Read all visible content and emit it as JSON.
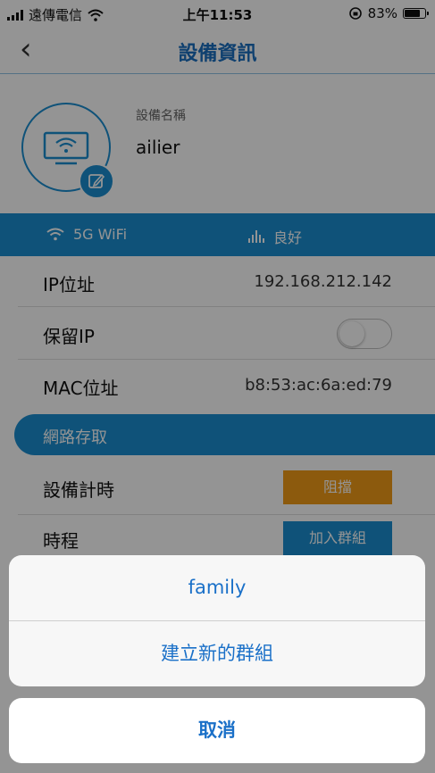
{
  "status_bar": {
    "carrier": "遠傳電信",
    "time": "上午11:53",
    "battery_percent_label": "83%",
    "battery_level": 0.83
  },
  "nav": {
    "back_glyph": "‹",
    "title": "設備資訊"
  },
  "device": {
    "name_label": "設備名稱",
    "name": "ailier"
  },
  "connection": {
    "band": "5G WiFi",
    "signal": "良好"
  },
  "info_rows": {
    "ip": {
      "label": "IP位址",
      "value": "192.168.212.142"
    },
    "reserve_ip": {
      "label": "保留IP",
      "enabled": false
    },
    "mac": {
      "label": "MAC位址",
      "value": "b8:53:ac:6a:ed:79"
    }
  },
  "network_access": {
    "section_title": "網路存取",
    "timer": {
      "label": "設備計時",
      "button": "阻擋"
    },
    "schedule": {
      "label": "時程",
      "button": "加入群組"
    }
  },
  "action_sheet": {
    "options": [
      "family",
      "建立新的群組"
    ],
    "cancel": "取消"
  },
  "colors": {
    "accent": "#1a8ed0",
    "title_blue": "#1a6fc0",
    "orange": "#f29b17"
  }
}
